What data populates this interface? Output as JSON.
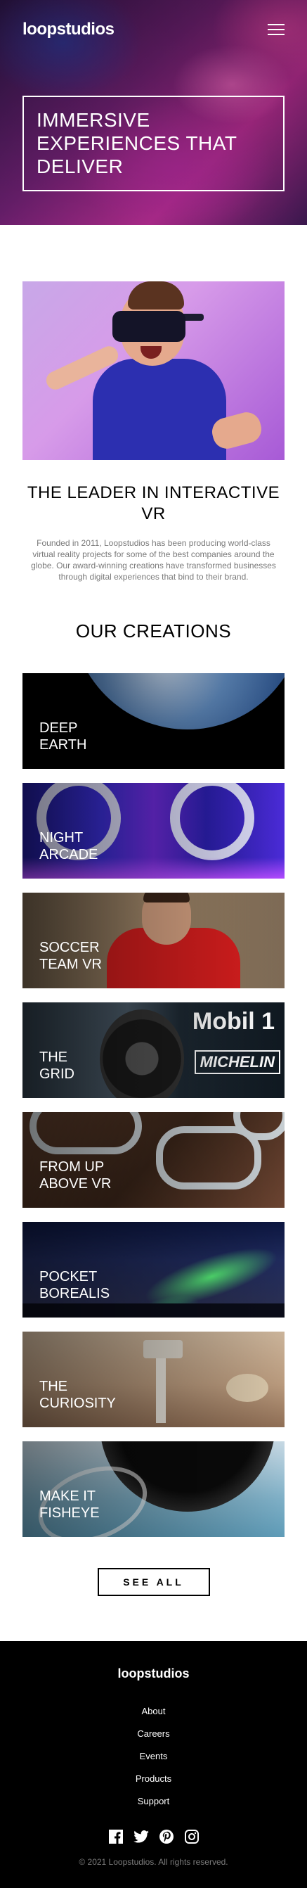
{
  "header": {
    "logo": "loopstudios",
    "hero_title": "Immersive experiences that deliver"
  },
  "intro": {
    "title": "The leader in interactive VR",
    "text": "Founded in 2011, Loopstudios has been producing world-class virtual reality projects for some of the best companies around the globe. Our award-winning creations have transformed businesses through digital experiences that bind to their brand."
  },
  "creations": {
    "title": "Our creations",
    "items": [
      {
        "label": "Deep\nearth"
      },
      {
        "label": "Night\narcade"
      },
      {
        "label": "Soccer\nteam VR"
      },
      {
        "label": "The\ngrid"
      },
      {
        "label": "From up\nabove VR"
      },
      {
        "label": "Pocket\nborealis"
      },
      {
        "label": "The\ncuriosity"
      },
      {
        "label": "Make it\nfisheye"
      }
    ],
    "see_all": "See all"
  },
  "footer": {
    "logo": "loopstudios",
    "links": [
      "About",
      "Careers",
      "Events",
      "Products",
      "Support"
    ],
    "socials": [
      "facebook-icon",
      "twitter-icon",
      "pinterest-icon",
      "instagram-icon"
    ],
    "copyright": "© 2021 Loopstudios. All rights reserved."
  },
  "colors": {
    "footer_bg": "#000000",
    "text_muted": "#7a7a7a",
    "white": "#ffffff"
  }
}
